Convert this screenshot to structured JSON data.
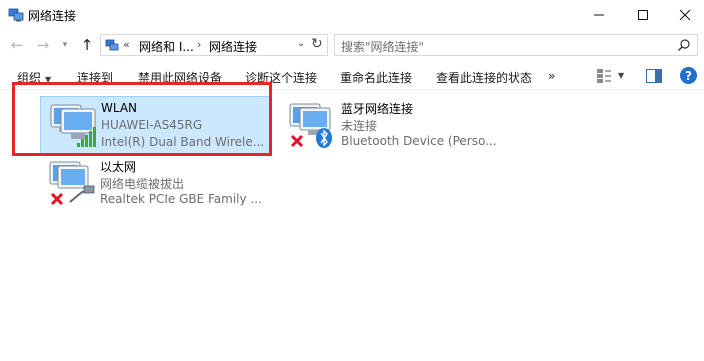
{
  "window": {
    "title": "网络连接"
  },
  "address": {
    "crumbs": [
      "网络和 I...",
      "网络连接"
    ],
    "separator": "«",
    "arrow": "›"
  },
  "search": {
    "placeholder": "搜索\"网络连接\""
  },
  "commands": [
    "组织",
    "连接到",
    "禁用此网络设备",
    "诊断这个连接",
    "重命名此连接",
    "查看此连接的状态",
    "»"
  ],
  "connections": [
    {
      "name": "WLAN",
      "status": "HUAWEI-AS45RG",
      "device": "Intel(R) Dual Band Wirele..."
    },
    {
      "name": "蓝牙网络连接",
      "status": "未连接",
      "device": "Bluetooth Device (Perso..."
    },
    {
      "name": "以太网",
      "status": "网络电缆被拔出",
      "device": "Realtek PCIe GBE Family ..."
    }
  ],
  "colors": {
    "selection": "#cce8ff",
    "highlight_box": "#e3262a",
    "signal": "#3cab3c",
    "error": "#e81123",
    "bluetooth": "#1e7cd8"
  },
  "icons": [
    "app-network-icon",
    "back-icon",
    "forward-icon",
    "up-icon",
    "refresh-icon",
    "search-icon",
    "view-icon",
    "preview-pane-icon",
    "help-icon",
    "computer-icon",
    "wifi-signal-icon",
    "bluetooth-icon",
    "error-x-icon",
    "ethernet-cable-icon"
  ]
}
